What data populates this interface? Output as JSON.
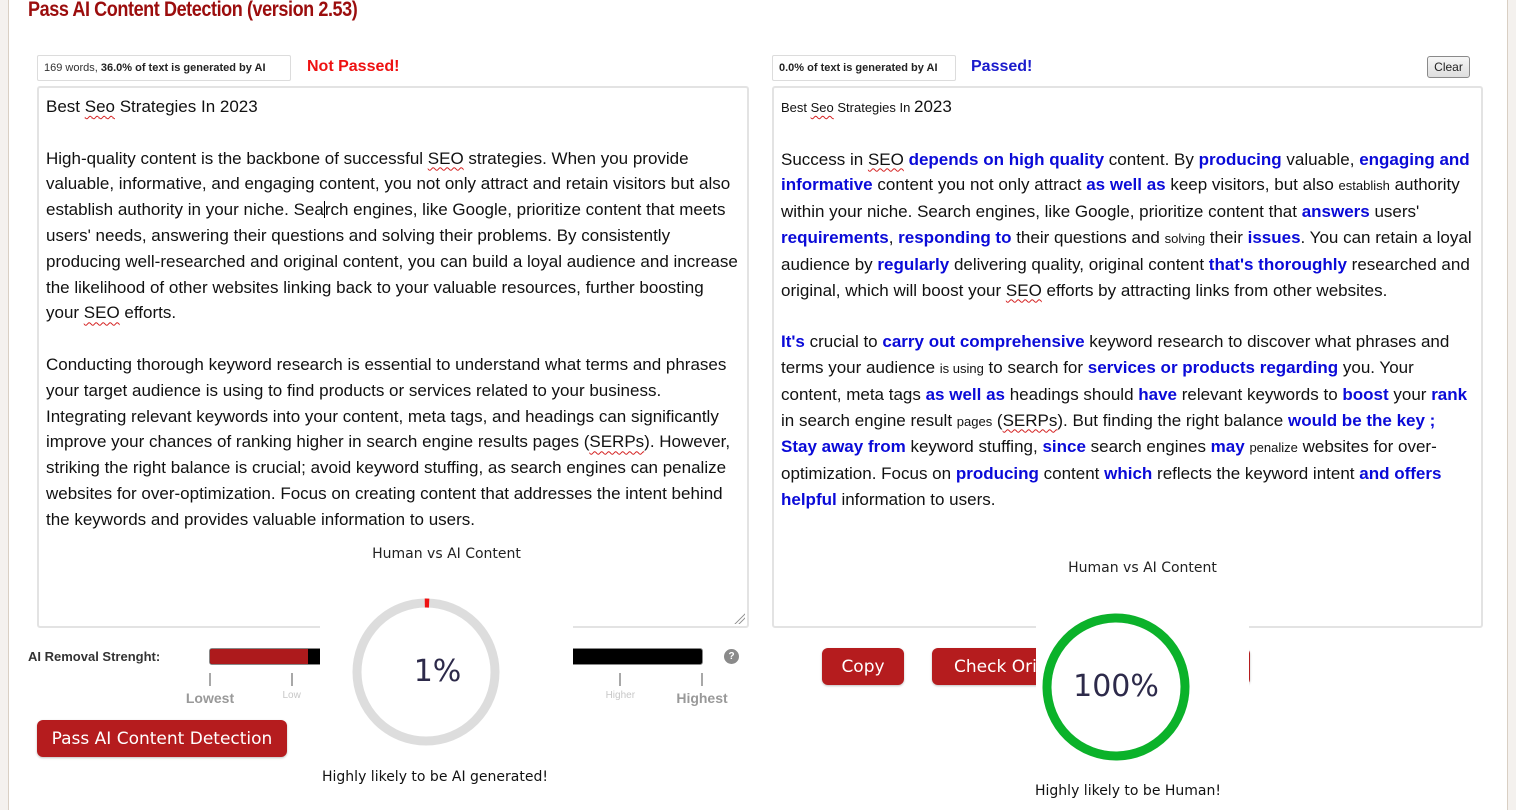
{
  "app": {
    "title": "Pass AI Content Detection (version 2.53)"
  },
  "input_panel": {
    "stats_words": "169 words, ",
    "stats_ai": "36.0% of text is generated by AI",
    "status": "Not Passed!",
    "status_color": "#ee1111",
    "title_line": {
      "pre": "Best ",
      "spell": "Seo",
      "post": " Strategies In 2023"
    },
    "paragraph1": {
      "a": "High-quality content is the backbone of successful ",
      "spell1": "SEO",
      "b": " strategies. When you provide valuable, informative, and engaging content, you not only attract and retain visitors but also establish authority in your niche. Sea",
      "c": "rch engines, like Google, prioritize content that meets users' needs, answering their questions and solving their problems. By consistently producing well-researched and original content, you can build a loyal audience and increase the likelihood of other websites linking back to your valuable resources, further boosting your ",
      "spell2": "SEO",
      "d": " efforts."
    },
    "paragraph2": {
      "a": "Conducting thorough keyword research is essential to understand what terms and phrases your target audience is using to find products or services related to your business. Integrating relevant keywords into your content, meta tags, and headings can significantly improve your chances of ranking higher in search engine results pages (",
      "spell": "SERPs",
      "b": "). However, striking the right balance is crucial; avoid keyword stuffing, as search engines can penalize websites for over-optimization. Focus on creating content that addresses the intent behind the keywords and provides valuable information to users."
    }
  },
  "output_panel": {
    "stats_ai": "0.0% of text is generated by AI",
    "status": "Passed!",
    "status_color": "#1a1acc",
    "clear_label": "Clear",
    "title_line": {
      "pre": "Best ",
      "spell": "Seo",
      "mid": " Strategies In ",
      "year": "2023"
    },
    "paragraph1": [
      {
        "t": "Success in ",
        "k": "n"
      },
      {
        "t": "SEO",
        "k": "spell"
      },
      {
        "t": " ",
        "k": "n"
      },
      {
        "t": "depends on high quality",
        "k": "hl"
      },
      {
        "t": " content. By ",
        "k": "n"
      },
      {
        "t": "producing",
        "k": "hl"
      },
      {
        "t": " valuable, ",
        "k": "n"
      },
      {
        "t": "engaging and informative",
        "k": "hl"
      },
      {
        "t": " content you not only attract ",
        "k": "n"
      },
      {
        "t": "as well as",
        "k": "hl"
      },
      {
        "t": " keep visitors, but also ",
        "k": "n"
      },
      {
        "t": "establish",
        "k": "sm"
      },
      {
        "t": " authority within your niche. Search engines, like Google, prioritize content that ",
        "k": "n"
      },
      {
        "t": "answers",
        "k": "hl"
      },
      {
        "t": " users' ",
        "k": "n"
      },
      {
        "t": "requirements",
        "k": "hl"
      },
      {
        "t": ", ",
        "k": "n"
      },
      {
        "t": "responding to",
        "k": "hl"
      },
      {
        "t": " their questions and ",
        "k": "n"
      },
      {
        "t": "solving",
        "k": "sm"
      },
      {
        "t": " their ",
        "k": "n"
      },
      {
        "t": "issues",
        "k": "hl"
      },
      {
        "t": ". You can retain a loyal audience by ",
        "k": "n"
      },
      {
        "t": "regularly",
        "k": "hl"
      },
      {
        "t": " delivering quality, original content ",
        "k": "n"
      },
      {
        "t": "that's thoroughly",
        "k": "hl"
      },
      {
        "t": " researched and original, which will boost your ",
        "k": "n"
      },
      {
        "t": "SEO",
        "k": "spell"
      },
      {
        "t": " efforts by attracting links from other websites.",
        "k": "n"
      }
    ],
    "paragraph2": [
      {
        "t": "It's",
        "k": "hl"
      },
      {
        "t": " crucial to ",
        "k": "n"
      },
      {
        "t": "carry out comprehensive",
        "k": "hl"
      },
      {
        "t": " keyword research to discover what phrases and terms your audience ",
        "k": "n"
      },
      {
        "t": "is using",
        "k": "sm"
      },
      {
        "t": " to search for ",
        "k": "n"
      },
      {
        "t": "services or products regarding",
        "k": "hl"
      },
      {
        "t": " you. Your content, meta tags ",
        "k": "n"
      },
      {
        "t": "as well as",
        "k": "hl"
      },
      {
        "t": " headings should ",
        "k": "n"
      },
      {
        "t": "have",
        "k": "hl"
      },
      {
        "t": " relevant keywords to ",
        "k": "n"
      },
      {
        "t": "boost",
        "k": "hl"
      },
      {
        "t": " your ",
        "k": "n"
      },
      {
        "t": "rank",
        "k": "hl"
      },
      {
        "t": " in search engine result ",
        "k": "n"
      },
      {
        "t": "pages",
        "k": "sm"
      },
      {
        "t": " (",
        "k": "n"
      },
      {
        "t": "SERPs",
        "k": "spell"
      },
      {
        "t": "). But finding the right balance ",
        "k": "n"
      },
      {
        "t": "would be the key ; Stay away from",
        "k": "hl"
      },
      {
        "t": " keyword stuffing, ",
        "k": "n"
      },
      {
        "t": "since",
        "k": "hl"
      },
      {
        "t": " search engines ",
        "k": "n"
      },
      {
        "t": "may",
        "k": "hl"
      },
      {
        "t": " ",
        "k": "n"
      },
      {
        "t": "penalize",
        "k": "sm"
      },
      {
        "t": " websites for over-optimization. Focus on ",
        "k": "n"
      },
      {
        "t": "producing",
        "k": "hl"
      },
      {
        "t": " content ",
        "k": "n"
      },
      {
        "t": "which",
        "k": "hl"
      },
      {
        "t": " reflects the keyword intent ",
        "k": "n"
      },
      {
        "t": "and offers helpful",
        "k": "hl"
      },
      {
        "t": " information to users.",
        "k": "n"
      }
    ],
    "copy_label": "Copy",
    "check_label": "Check Orig"
  },
  "slider": {
    "label": "AI Removal Strenght:",
    "value_fraction": 0.2,
    "ticks": [
      {
        "label": "Lowest",
        "size": "big",
        "pos": 0
      },
      {
        "label": "Low",
        "size": "small",
        "pos": 0.166
      },
      {
        "label": "Higher",
        "size": "small",
        "pos": 0.834
      },
      {
        "label": "Highest",
        "size": "big",
        "pos": 1
      }
    ],
    "help_icon": "?",
    "fill_color": "#ad1a1c"
  },
  "pass_button_label": "Pass AI Content Detection",
  "gauges": [
    {
      "title": "Human vs AI Content",
      "value": "1%",
      "percent": 1,
      "caption": "Highly likely to be AI generated!",
      "color": "#ee1111",
      "track": "#dddddd"
    },
    {
      "title": "Human vs AI Content",
      "value": "100%",
      "percent": 100,
      "caption": "Highly likely to be Human!",
      "color": "#0bb22a",
      "track": "#dddddd"
    }
  ]
}
